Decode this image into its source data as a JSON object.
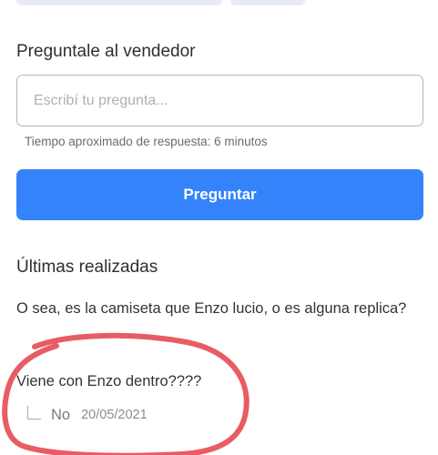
{
  "ask_section": {
    "title": "Preguntale al vendedor",
    "input_placeholder": "Escribí tu pregunta...",
    "response_time": "Tiempo aproximado de respuesta: 6 minutos",
    "button_label": "Preguntar"
  },
  "recent_section": {
    "title": "Últimas realizadas",
    "questions": [
      {
        "text": "O sea, es la camiseta que Enzo lucio, o es alguna replica?"
      },
      {
        "text": "Viene con Enzo dentro????",
        "answer": "No",
        "date": "20/05/2021"
      }
    ]
  },
  "colors": {
    "accent": "#3483fa",
    "annotation": "#e85c63"
  }
}
